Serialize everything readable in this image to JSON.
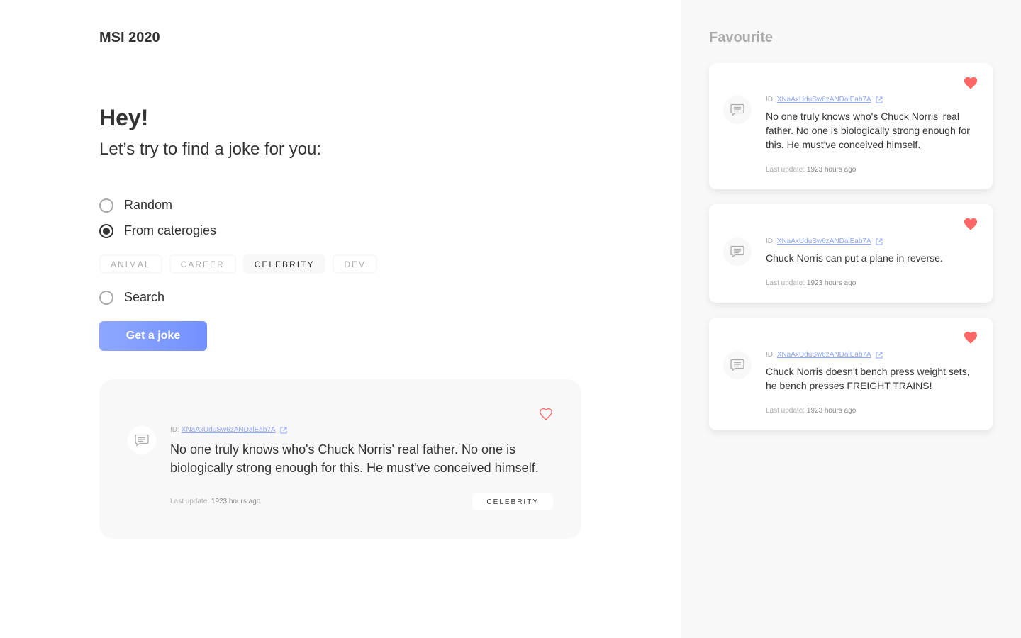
{
  "app": {
    "title": "MSI 2020"
  },
  "hero": {
    "greeting": "Hey!",
    "subtitle": "Let’s try to find a joke for you:"
  },
  "options": {
    "random": "Random",
    "categories": "From caterogies",
    "search": "Search",
    "selected": "categories"
  },
  "categories": [
    {
      "label": "ANIMAL",
      "active": false
    },
    {
      "label": "CAREER",
      "active": false
    },
    {
      "label": "CELEBRITY",
      "active": true
    },
    {
      "label": "DEV",
      "active": false
    }
  ],
  "button": {
    "label": "Get a joke"
  },
  "joke": {
    "id_prefix": "ID:",
    "id": "XNaAxUduSw6zANDalEab7A",
    "text": "No one truly knows who's Chuck Norris' real father. No one is biologically strong enough for this. He must've conceived himself.",
    "update_label": "Last update:",
    "update_value": "1923 hours ago",
    "category": "CELEBRITY",
    "favourite": false
  },
  "favourites": {
    "title": "Favourite",
    "items": [
      {
        "id_prefix": "ID:",
        "id": "XNaAxUduSw6zANDalEab7A",
        "text": "No one truly knows who's Chuck Norris' real father. No one is biologically strong enough for this. He must've conceived himself.",
        "update_label": "Last update:",
        "update_value": "1923 hours ago"
      },
      {
        "id_prefix": "ID:",
        "id": "XNaAxUduSw6zANDalEab7A",
        "text": "Chuck Norris can put a plane in reverse.",
        "update_label": "Last update:",
        "update_value": "1923 hours ago"
      },
      {
        "id_prefix": "ID:",
        "id": "XNaAxUduSw6zANDalEab7A",
        "text": "Chuck Norris doesn't bench press weight sets, he bench presses FREIGHT TRAINS!",
        "update_label": "Last update:",
        "update_value": "1923 hours ago"
      }
    ]
  },
  "colors": {
    "accent": "#8EA7FF",
    "heart": "#FF6767",
    "text": "#333333",
    "muted": "#ABABAB",
    "panel": "#F8F8F8"
  },
  "icons": {
    "message": "message-icon",
    "heart": "heart-icon",
    "external": "external-link-icon"
  }
}
